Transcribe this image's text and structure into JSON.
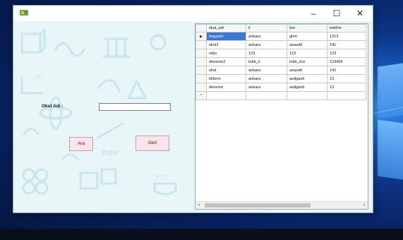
{
  "window": {
    "title": "",
    "minimize": "–",
    "maximize": "☐",
    "close": "✕"
  },
  "form": {
    "label_okul_adi": "Okul Adı :",
    "input_value": "",
    "btn_ara": "Ara",
    "btn_geri": "Geri"
  },
  "grid": {
    "columns": [
      "okul_adi",
      "il",
      "ilce",
      "telefon"
    ],
    "rows": [
      [
        "bogazici",
        "ankara",
        "ghm",
        "1212"
      ],
      [
        "okul2",
        "ankara",
        "asasdd",
        "141"
      ],
      [
        "odtu",
        "123",
        "123",
        "123"
      ],
      [
        "deneme2",
        "tobb_il",
        "tobb_ilce",
        "123456"
      ],
      [
        "okul",
        "ankara",
        "asasdd",
        "141"
      ],
      [
        "bilkent",
        "ankara",
        "asdgasd",
        "13"
      ],
      [
        "deneme",
        "ankara",
        "asdgasd",
        "13"
      ]
    ],
    "current_row_marker": "▶",
    "new_row_marker": "*",
    "scroll_left": "<",
    "scroll_right": ">"
  },
  "colors": {
    "selection": "#3b78d4",
    "window_bg": "#e8f6f8",
    "button_bg": "#fde3ea"
  }
}
